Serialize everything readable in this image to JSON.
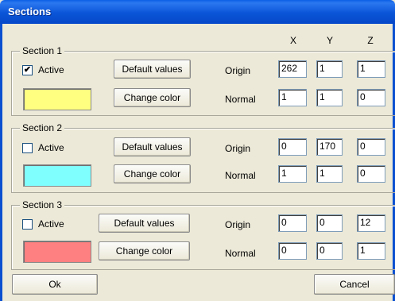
{
  "window": {
    "title": "Sections"
  },
  "columns": {
    "x": "X",
    "y": "Y",
    "z": "Z"
  },
  "sections": [
    {
      "label": "Section 1",
      "active": true,
      "check_mark": "✔",
      "active_label": "Active",
      "default_button": "Default values",
      "color_button": "Change color",
      "color": "#ffff80",
      "origin_label": "Origin",
      "normal_label": "Normal",
      "origin": [
        "262",
        "1",
        "1"
      ],
      "normal": [
        "1",
        "1",
        "0"
      ]
    },
    {
      "label": "Section 2",
      "active": false,
      "check_mark": "",
      "active_label": "Active",
      "default_button": "Default values",
      "color_button": "Change color",
      "color": "#80ffff",
      "origin_label": "Origin",
      "normal_label": "Normal",
      "origin": [
        "0",
        "170",
        "0"
      ],
      "normal": [
        "1",
        "1",
        "0"
      ]
    },
    {
      "label": "Section 3",
      "active": false,
      "check_mark": "",
      "active_label": "Active",
      "default_button": "Default values",
      "color_button": "Change color",
      "color": "#ff8080",
      "origin_label": "Origin",
      "normal_label": "Normal",
      "origin": [
        "0",
        "0",
        "12"
      ],
      "normal": [
        "0",
        "0",
        "1"
      ]
    }
  ],
  "footer": {
    "ok_label": "Ok",
    "cancel_label": "Cancel"
  },
  "colors": {
    "titlebar": "#0a55d8",
    "face": "#ece9d8"
  }
}
